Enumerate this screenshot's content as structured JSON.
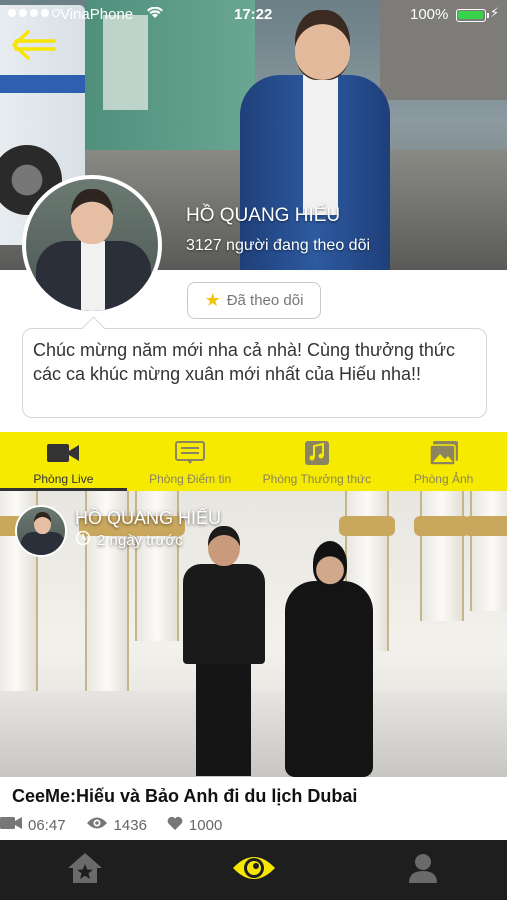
{
  "status_bar": {
    "carrier": "VinaPhone",
    "time": "17:22",
    "battery": "100%",
    "battery_level": 1.0,
    "signal_bars": 4
  },
  "profile": {
    "name": "HỒ QUANG HIẾU",
    "followers": "3127 người đang theo dõi",
    "follow_button": "Đã theo dõi",
    "message": "Chúc mừng năm mới nha cả nhà! Cùng thưởng thức các ca khúc mừng xuân mới nhất của Hiếu nha!!"
  },
  "tabs": [
    {
      "label": "Phòng Live",
      "icon": "video-camera-icon",
      "active": true
    },
    {
      "label": "Phòng Điểm tin",
      "icon": "news-icon",
      "active": false
    },
    {
      "label": "Phòng Thưởng thức",
      "icon": "music-icon",
      "active": false
    },
    {
      "label": "Phòng Ảnh",
      "icon": "photo-icon",
      "active": false
    }
  ],
  "video": {
    "author": "HỒ QUANG HIẾU",
    "posted": "2 ngày trước",
    "title": "CeeMe:Hiếu và Bảo Anh đi du lịch Dubai",
    "duration": "06:47",
    "views": "1436",
    "likes": "1000"
  },
  "bottom_nav": [
    {
      "icon": "home-star-icon"
    },
    {
      "icon": "eye-icon"
    },
    {
      "icon": "profile-icon"
    }
  ],
  "colors": {
    "accent_yellow": "#f6ea00",
    "bottom_nav_bg": "#1e1e1e",
    "eye_icon": "#f6e600"
  }
}
